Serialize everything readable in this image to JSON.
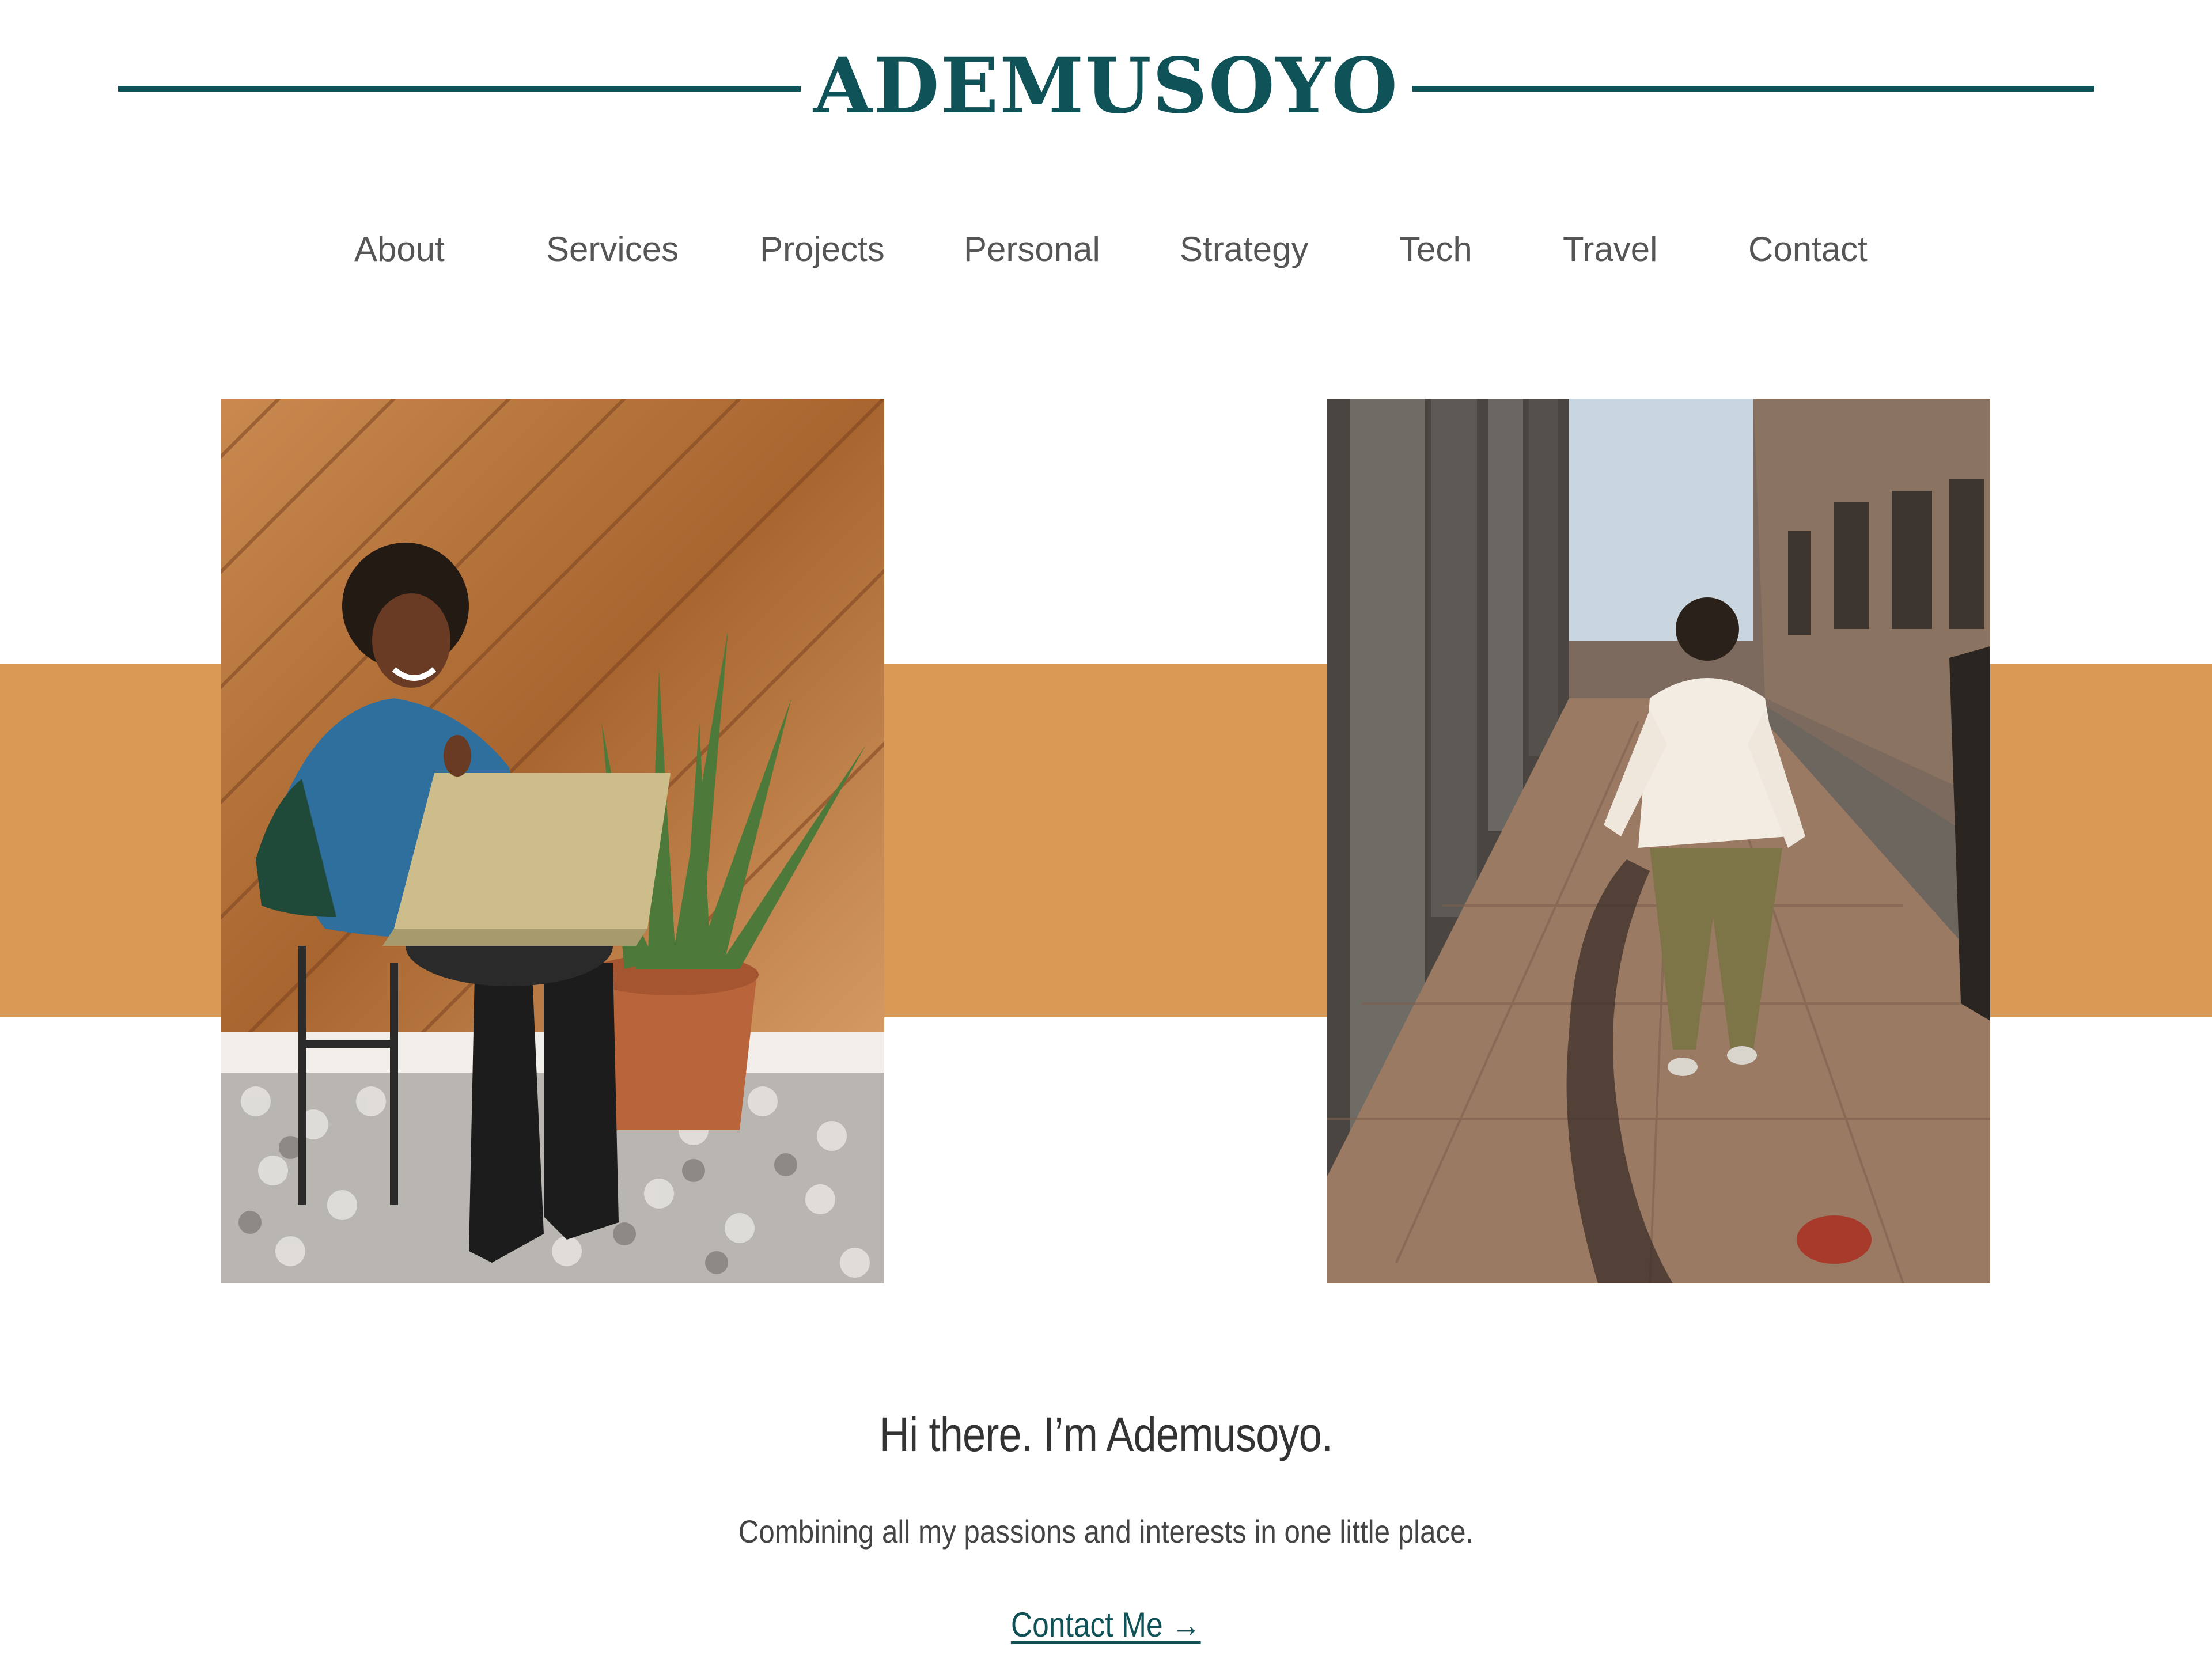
{
  "header": {
    "logo_text": "ADEMUSOYO"
  },
  "nav": {
    "items": [
      {
        "label": "About"
      },
      {
        "label": "Services"
      },
      {
        "label": "Projects"
      },
      {
        "label": "Personal"
      },
      {
        "label": "Strategy"
      },
      {
        "label": "Tech"
      },
      {
        "label": "Travel"
      },
      {
        "label": "Contact"
      }
    ]
  },
  "hero": {
    "left_photo": "woman-with-laptop-photo",
    "right_photo": "woman-walking-street-photo"
  },
  "intro": {
    "headline": "Hi there. I’m Ademusoyo.",
    "tagline": "Combining all my passions and interests in one little place.",
    "cta_label": "Contact Me →"
  },
  "colors": {
    "brand": "#0f5257",
    "accent_band": "#d99a55",
    "nav_text": "#555555",
    "body_text": "#333333"
  }
}
